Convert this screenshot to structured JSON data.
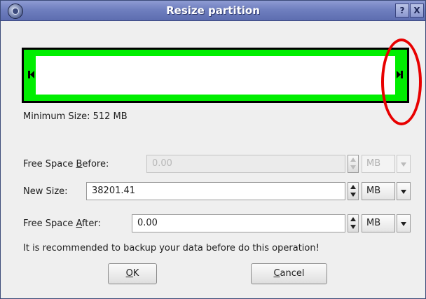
{
  "window": {
    "title": "Resize partition",
    "help_label": "?",
    "close_label": "X",
    "icon": "app-disk-icon"
  },
  "partition": {
    "fill_color": "#00ee00",
    "highlight_color": "#e80000"
  },
  "min_size_text": "Minimum Size: 512 MB",
  "fields": {
    "before": {
      "label_pre": "Free Space ",
      "label_accel": "B",
      "label_post": "efore:",
      "value": "0.00",
      "unit": "MB",
      "enabled": false
    },
    "size": {
      "label": "New Size:",
      "value": "38201.41",
      "unit": "MB",
      "enabled": true
    },
    "after": {
      "label_pre": "Free Space ",
      "label_accel": "A",
      "label_post": "fter:",
      "value": "0.00",
      "unit": "MB",
      "enabled": true
    }
  },
  "warning": "It is recommended to backup your data before do this operation!",
  "buttons": {
    "ok_accel": "O",
    "ok_rest": "K",
    "cancel_accel": "C",
    "cancel_rest": "ancel"
  }
}
